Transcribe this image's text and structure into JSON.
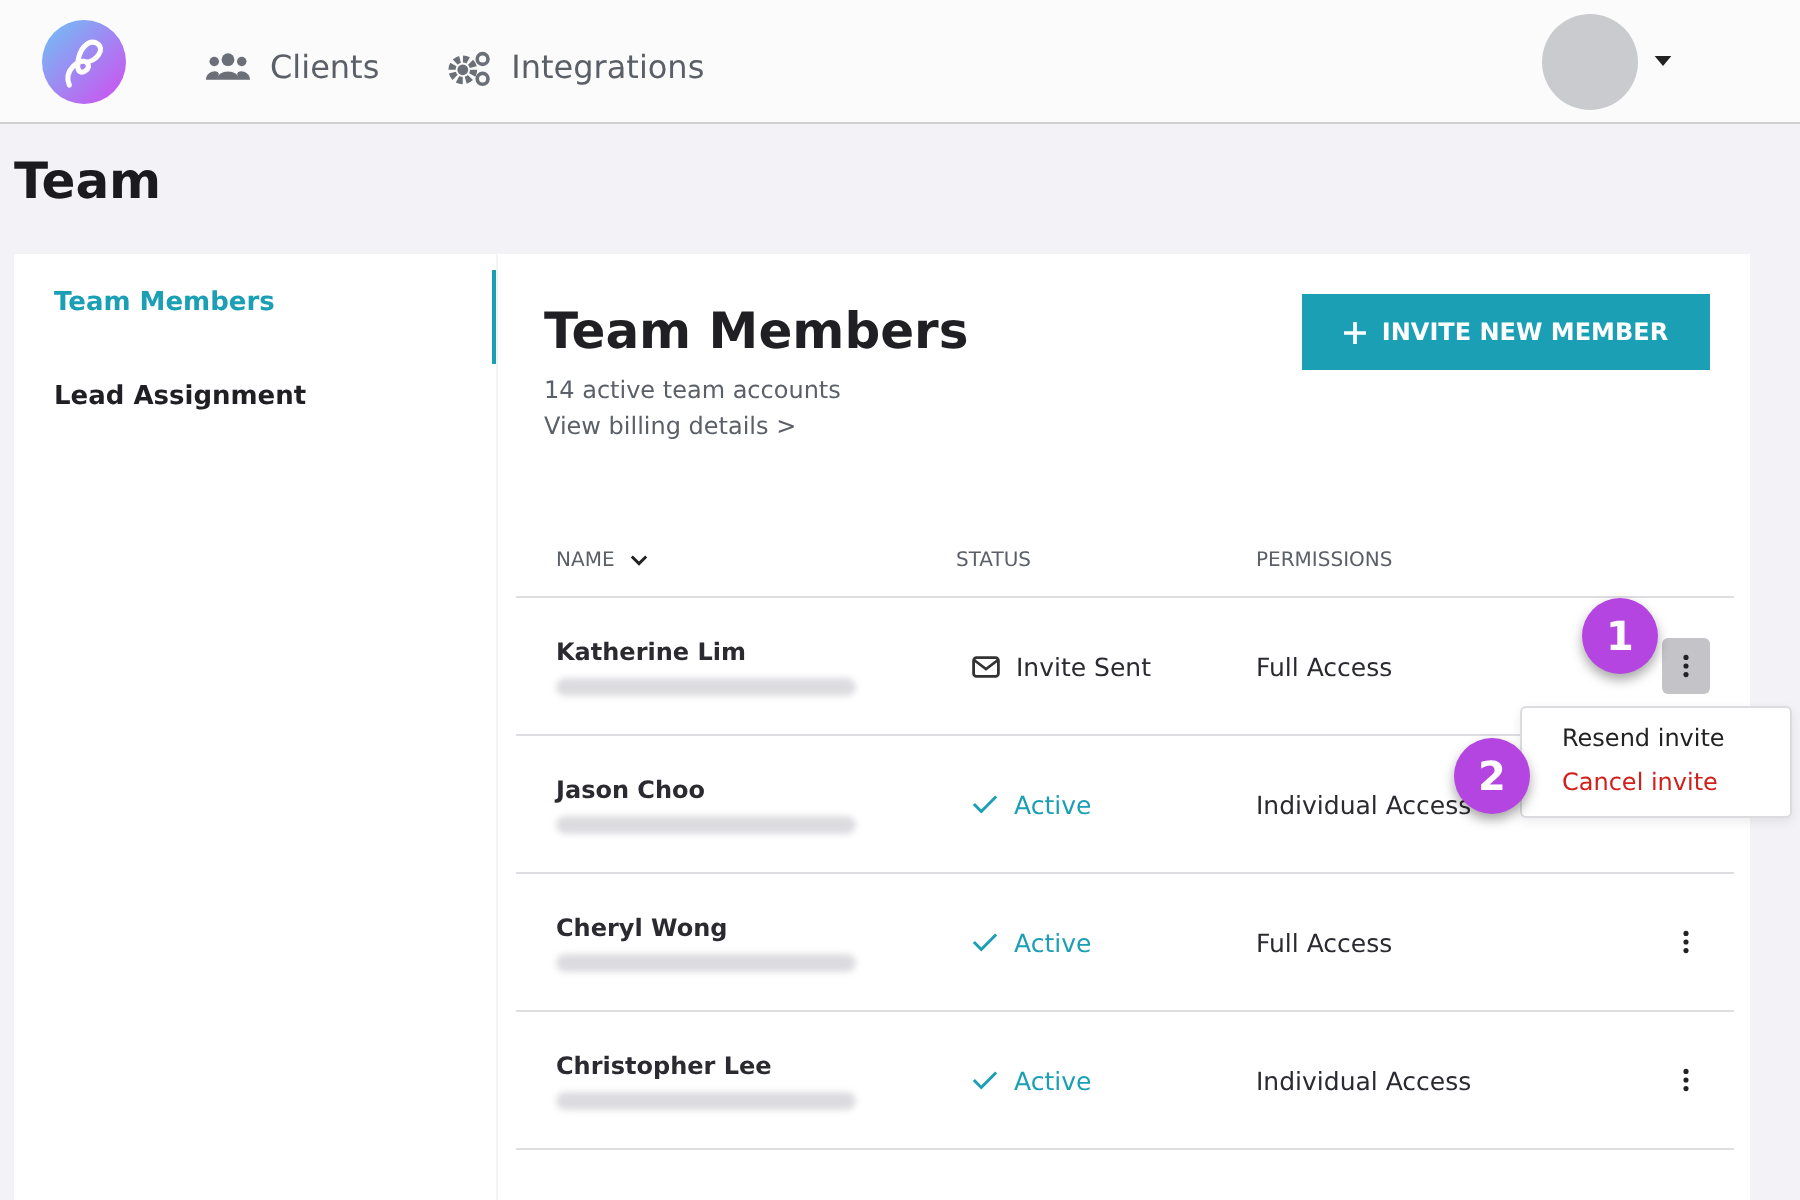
{
  "nav": {
    "items": [
      {
        "label": "Clients",
        "kind": "clients"
      },
      {
        "label": "Integrations",
        "kind": "integrations"
      }
    ]
  },
  "page_title": "Team",
  "sidebar": {
    "items": [
      {
        "label": "Team Members",
        "selected": true
      },
      {
        "label": "Lead Assignment",
        "selected": false
      }
    ]
  },
  "panel": {
    "title": "Team Members",
    "subtitle": "14 active team accounts",
    "billing_link": "View billing details >",
    "invite_button": "INVITE NEW MEMBER"
  },
  "table": {
    "columns": [
      {
        "label": "NAME",
        "sortable": true
      },
      {
        "label": "STATUS",
        "sortable": false
      },
      {
        "label": "PERMISSIONS",
        "sortable": false
      }
    ],
    "rows": [
      {
        "name": "Katherine Lim",
        "status": "Invite Sent",
        "kind": "invite",
        "permissions": "Full Access",
        "menu_open": true
      },
      {
        "name": "Jason Choo",
        "status": "Active",
        "kind": "active",
        "permissions": "Individual Access",
        "menu_open": false
      },
      {
        "name": "Cheryl Wong",
        "status": "Active",
        "kind": "active",
        "permissions": "Full Access",
        "menu_open": false
      },
      {
        "name": "Christopher Lee",
        "status": "Active",
        "kind": "active",
        "permissions": "Individual Access",
        "menu_open": false
      }
    ]
  },
  "row_menu": {
    "items": [
      {
        "label": "Resend invite",
        "kind": "normal"
      },
      {
        "label": "Cancel invite",
        "kind": "danger"
      }
    ]
  },
  "annotations": [
    {
      "label": "1"
    },
    {
      "label": "2"
    }
  ]
}
